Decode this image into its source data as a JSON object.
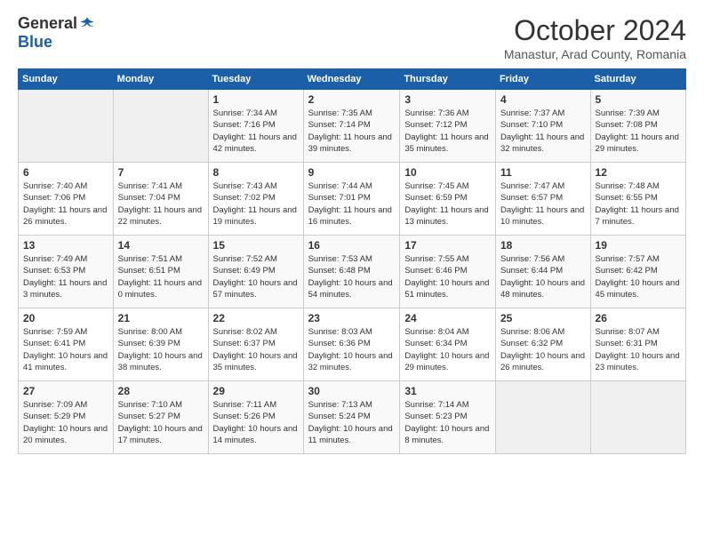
{
  "header": {
    "logo_general": "General",
    "logo_blue": "Blue",
    "title": "October 2024",
    "location": "Manastur, Arad County, Romania"
  },
  "days_of_week": [
    "Sunday",
    "Monday",
    "Tuesday",
    "Wednesday",
    "Thursday",
    "Friday",
    "Saturday"
  ],
  "weeks": [
    [
      {
        "day": "",
        "info": ""
      },
      {
        "day": "",
        "info": ""
      },
      {
        "day": "1",
        "info": "Sunrise: 7:34 AM\nSunset: 7:16 PM\nDaylight: 11 hours and 42 minutes."
      },
      {
        "day": "2",
        "info": "Sunrise: 7:35 AM\nSunset: 7:14 PM\nDaylight: 11 hours and 39 minutes."
      },
      {
        "day": "3",
        "info": "Sunrise: 7:36 AM\nSunset: 7:12 PM\nDaylight: 11 hours and 35 minutes."
      },
      {
        "day": "4",
        "info": "Sunrise: 7:37 AM\nSunset: 7:10 PM\nDaylight: 11 hours and 32 minutes."
      },
      {
        "day": "5",
        "info": "Sunrise: 7:39 AM\nSunset: 7:08 PM\nDaylight: 11 hours and 29 minutes."
      }
    ],
    [
      {
        "day": "6",
        "info": "Sunrise: 7:40 AM\nSunset: 7:06 PM\nDaylight: 11 hours and 26 minutes."
      },
      {
        "day": "7",
        "info": "Sunrise: 7:41 AM\nSunset: 7:04 PM\nDaylight: 11 hours and 22 minutes."
      },
      {
        "day": "8",
        "info": "Sunrise: 7:43 AM\nSunset: 7:02 PM\nDaylight: 11 hours and 19 minutes."
      },
      {
        "day": "9",
        "info": "Sunrise: 7:44 AM\nSunset: 7:01 PM\nDaylight: 11 hours and 16 minutes."
      },
      {
        "day": "10",
        "info": "Sunrise: 7:45 AM\nSunset: 6:59 PM\nDaylight: 11 hours and 13 minutes."
      },
      {
        "day": "11",
        "info": "Sunrise: 7:47 AM\nSunset: 6:57 PM\nDaylight: 11 hours and 10 minutes."
      },
      {
        "day": "12",
        "info": "Sunrise: 7:48 AM\nSunset: 6:55 PM\nDaylight: 11 hours and 7 minutes."
      }
    ],
    [
      {
        "day": "13",
        "info": "Sunrise: 7:49 AM\nSunset: 6:53 PM\nDaylight: 11 hours and 3 minutes."
      },
      {
        "day": "14",
        "info": "Sunrise: 7:51 AM\nSunset: 6:51 PM\nDaylight: 11 hours and 0 minutes."
      },
      {
        "day": "15",
        "info": "Sunrise: 7:52 AM\nSunset: 6:49 PM\nDaylight: 10 hours and 57 minutes."
      },
      {
        "day": "16",
        "info": "Sunrise: 7:53 AM\nSunset: 6:48 PM\nDaylight: 10 hours and 54 minutes."
      },
      {
        "day": "17",
        "info": "Sunrise: 7:55 AM\nSunset: 6:46 PM\nDaylight: 10 hours and 51 minutes."
      },
      {
        "day": "18",
        "info": "Sunrise: 7:56 AM\nSunset: 6:44 PM\nDaylight: 10 hours and 48 minutes."
      },
      {
        "day": "19",
        "info": "Sunrise: 7:57 AM\nSunset: 6:42 PM\nDaylight: 10 hours and 45 minutes."
      }
    ],
    [
      {
        "day": "20",
        "info": "Sunrise: 7:59 AM\nSunset: 6:41 PM\nDaylight: 10 hours and 41 minutes."
      },
      {
        "day": "21",
        "info": "Sunrise: 8:00 AM\nSunset: 6:39 PM\nDaylight: 10 hours and 38 minutes."
      },
      {
        "day": "22",
        "info": "Sunrise: 8:02 AM\nSunset: 6:37 PM\nDaylight: 10 hours and 35 minutes."
      },
      {
        "day": "23",
        "info": "Sunrise: 8:03 AM\nSunset: 6:36 PM\nDaylight: 10 hours and 32 minutes."
      },
      {
        "day": "24",
        "info": "Sunrise: 8:04 AM\nSunset: 6:34 PM\nDaylight: 10 hours and 29 minutes."
      },
      {
        "day": "25",
        "info": "Sunrise: 8:06 AM\nSunset: 6:32 PM\nDaylight: 10 hours and 26 minutes."
      },
      {
        "day": "26",
        "info": "Sunrise: 8:07 AM\nSunset: 6:31 PM\nDaylight: 10 hours and 23 minutes."
      }
    ],
    [
      {
        "day": "27",
        "info": "Sunrise: 7:09 AM\nSunset: 5:29 PM\nDaylight: 10 hours and 20 minutes."
      },
      {
        "day": "28",
        "info": "Sunrise: 7:10 AM\nSunset: 5:27 PM\nDaylight: 10 hours and 17 minutes."
      },
      {
        "day": "29",
        "info": "Sunrise: 7:11 AM\nSunset: 5:26 PM\nDaylight: 10 hours and 14 minutes."
      },
      {
        "day": "30",
        "info": "Sunrise: 7:13 AM\nSunset: 5:24 PM\nDaylight: 10 hours and 11 minutes."
      },
      {
        "day": "31",
        "info": "Sunrise: 7:14 AM\nSunset: 5:23 PM\nDaylight: 10 hours and 8 minutes."
      },
      {
        "day": "",
        "info": ""
      },
      {
        "day": "",
        "info": ""
      }
    ]
  ]
}
